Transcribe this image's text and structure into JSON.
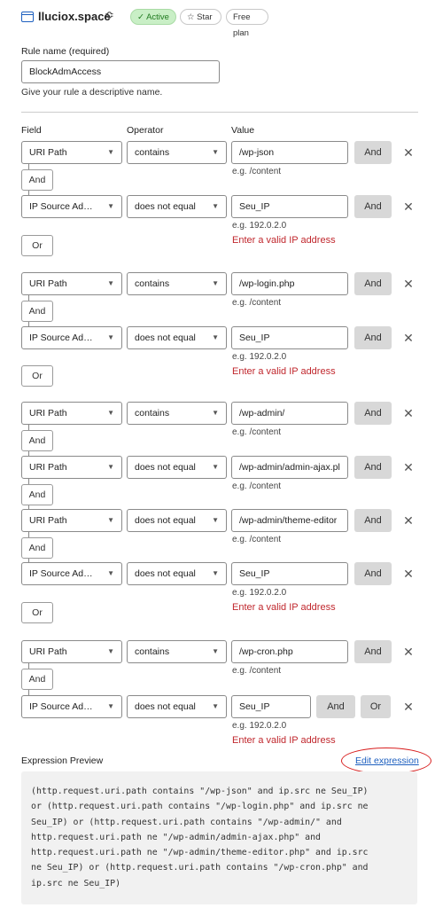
{
  "header": {
    "site_name": "lluciox.space",
    "chevron": "≎",
    "status_badge": "✓ Active",
    "star_badge": "☆ Star",
    "plan_badge": "Free plan"
  },
  "rule_name": {
    "label": "Rule name (required)",
    "value": "BlockAdmAccess",
    "help": "Give your rule a descriptive name."
  },
  "columns": {
    "field": "Field",
    "operator": "Operator",
    "value": "Value"
  },
  "groups": [
    {
      "conditions": [
        {
          "field": "URI Path",
          "operator": "contains",
          "value": "/wp-json",
          "hint": "e.g. /content",
          "connector": "And"
        },
        {
          "field": "IP Source Addr...",
          "operator": "does not equal",
          "value": "Seu_IP",
          "hint": "e.g. 192.0.2.0",
          "error": "Enter a valid IP address"
        }
      ],
      "group_connector": "Or"
    },
    {
      "conditions": [
        {
          "field": "URI Path",
          "operator": "contains",
          "value": "/wp-login.php",
          "hint": "e.g. /content",
          "connector": "And"
        },
        {
          "field": "IP Source Addr...",
          "operator": "does not equal",
          "value": "Seu_IP",
          "hint": "e.g. 192.0.2.0",
          "error": "Enter a valid IP address"
        }
      ],
      "group_connector": "Or"
    },
    {
      "conditions": [
        {
          "field": "URI Path",
          "operator": "contains",
          "value": "/wp-admin/",
          "hint": "e.g. /content",
          "connector": "And"
        },
        {
          "field": "URI Path",
          "operator": "does not equal",
          "value": "/wp-admin/admin-ajax.pl",
          "hint": "e.g. /content",
          "connector": "And"
        },
        {
          "field": "URI Path",
          "operator": "does not equal",
          "value": "/wp-admin/theme-editor",
          "hint": "e.g. /content",
          "connector": "And"
        },
        {
          "field": "IP Source Addr...",
          "operator": "does not equal",
          "value": "Seu_IP",
          "hint": "e.g. 192.0.2.0",
          "error": "Enter a valid IP address"
        }
      ],
      "group_connector": "Or"
    },
    {
      "conditions": [
        {
          "field": "URI Path",
          "operator": "contains",
          "value": "/wp-cron.php",
          "hint": "e.g. /content",
          "connector": "And"
        },
        {
          "field": "IP Source Addr...",
          "operator": "does not equal",
          "value": "Seu_IP",
          "hint": "e.g. 192.0.2.0",
          "error": "Enter a valid IP address"
        }
      ]
    }
  ],
  "buttons": {
    "and": "And",
    "or": "Or",
    "remove": "✕"
  },
  "dropdown_arrow": "▼",
  "expression_preview": {
    "label": "Expression Preview",
    "edit_link": "Edit expression",
    "code": "(http.request.uri.path contains \"/wp-json\" and ip.src ne Seu_IP)\nor (http.request.uri.path contains \"/wp-login.php\" and ip.src ne\nSeu_IP) or (http.request.uri.path contains \"/wp-admin/\" and\nhttp.request.uri.path ne \"/wp-admin/admin-ajax.php\" and\nhttp.request.uri.path ne \"/wp-admin/theme-editor.php\" and ip.src\nne Seu_IP) or (http.request.uri.path contains \"/wp-cron.php\" and\nip.src ne Seu_IP)"
  },
  "colors": {
    "accent": "#1d5fbf",
    "error": "#c0272d",
    "active_badge_bg": "#c9efc6",
    "highlight_ring": "#d81f1f"
  }
}
